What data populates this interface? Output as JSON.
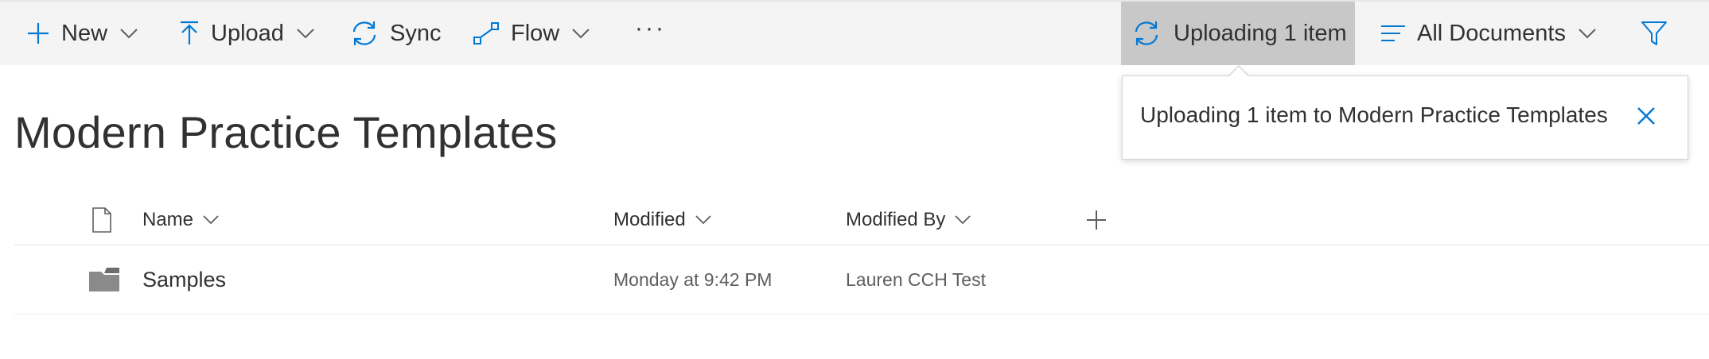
{
  "toolbar": {
    "new_label": "New",
    "upload_label": "Upload",
    "sync_label": "Sync",
    "flow_label": "Flow",
    "more_label": "···",
    "uploading_label": "Uploading 1 item",
    "view_label": "All Documents"
  },
  "callout": {
    "message": "Uploading 1 item to Modern Practice Templates"
  },
  "page": {
    "title": "Modern Practice Templates"
  },
  "columns": {
    "name": "Name",
    "modified": "Modified",
    "modified_by": "Modified By"
  },
  "rows": [
    {
      "name": "Samples",
      "modified": "Monday at 9:42 PM",
      "modified_by": "Lauren CCH Test",
      "icon": "folder-icon"
    }
  ],
  "colors": {
    "accent": "#0078d4",
    "toolbar_bg": "#f4f4f4",
    "active_bg": "#c8c8c8",
    "text": "#323130",
    "muted_text": "#605e5c",
    "folder": "#8a8a8a"
  }
}
